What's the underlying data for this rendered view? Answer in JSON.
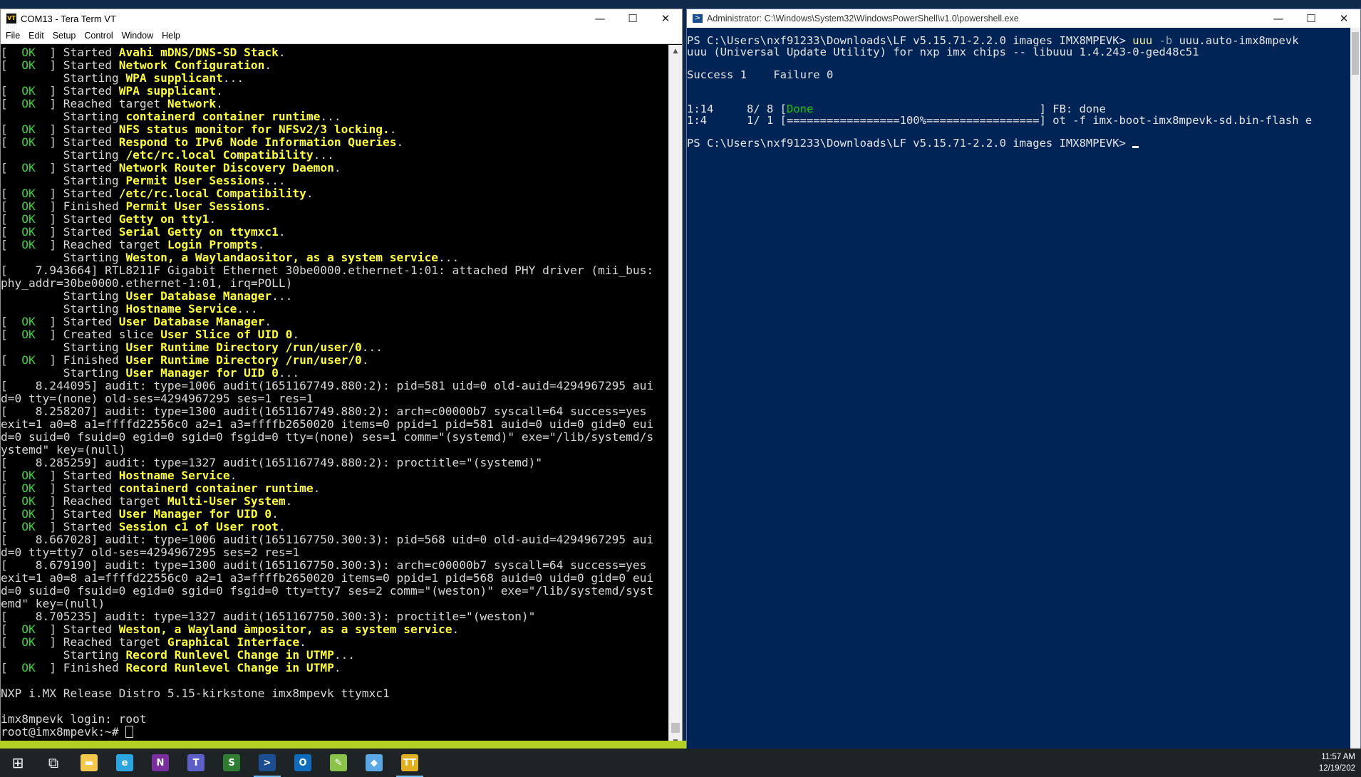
{
  "teraterm": {
    "title": "COM13 - Tera Term VT",
    "icon_label": "VT",
    "menu": [
      "File",
      "Edit",
      "Setup",
      "Control",
      "Window",
      "Help"
    ],
    "lines": [
      [
        [
          "[  ",
          "n"
        ],
        [
          "OK",
          "ok"
        ],
        [
          "  ] Started ",
          "n"
        ],
        [
          "Avahi mDNS/DNS-SD Stack",
          "hl"
        ],
        [
          ".",
          "n"
        ]
      ],
      [
        [
          "[  ",
          "n"
        ],
        [
          "OK",
          "ok"
        ],
        [
          "  ] Started ",
          "n"
        ],
        [
          "Network Configuration",
          "hl"
        ],
        [
          ".",
          "n"
        ]
      ],
      [
        [
          "         Starting ",
          "n"
        ],
        [
          "WPA supplicant",
          "hl"
        ],
        [
          "...",
          "n"
        ]
      ],
      [
        [
          "[  ",
          "n"
        ],
        [
          "OK",
          "ok"
        ],
        [
          "  ] Started ",
          "n"
        ],
        [
          "WPA supplicant",
          "hl"
        ],
        [
          ".",
          "n"
        ]
      ],
      [
        [
          "[  ",
          "n"
        ],
        [
          "OK",
          "ok"
        ],
        [
          "  ] Reached target ",
          "n"
        ],
        [
          "Network",
          "hl"
        ],
        [
          ".",
          "n"
        ]
      ],
      [
        [
          "         Starting ",
          "n"
        ],
        [
          "containerd container runtime",
          "hl"
        ],
        [
          "...",
          "n"
        ]
      ],
      [
        [
          "[  ",
          "n"
        ],
        [
          "OK",
          "ok"
        ],
        [
          "  ] Started ",
          "n"
        ],
        [
          "NFS status monitor for NFSv2/3 locking.",
          "hl"
        ],
        [
          ".",
          "n"
        ]
      ],
      [
        [
          "[  ",
          "n"
        ],
        [
          "OK",
          "ok"
        ],
        [
          "  ] Started ",
          "n"
        ],
        [
          "Respond to IPv6 Node Information Queries",
          "hl"
        ],
        [
          ".",
          "n"
        ]
      ],
      [
        [
          "         Starting ",
          "n"
        ],
        [
          "/etc/rc.local Compatibility",
          "hl"
        ],
        [
          "...",
          "n"
        ]
      ],
      [
        [
          "[  ",
          "n"
        ],
        [
          "OK",
          "ok"
        ],
        [
          "  ] Started ",
          "n"
        ],
        [
          "Network Router Discovery Daemon",
          "hl"
        ],
        [
          ".",
          "n"
        ]
      ],
      [
        [
          "         Starting ",
          "n"
        ],
        [
          "Permit User Sessions",
          "hl"
        ],
        [
          "...",
          "n"
        ]
      ],
      [
        [
          "[  ",
          "n"
        ],
        [
          "OK",
          "ok"
        ],
        [
          "  ] Started ",
          "n"
        ],
        [
          "/etc/rc.local Compatibility",
          "hl"
        ],
        [
          ".",
          "n"
        ]
      ],
      [
        [
          "[  ",
          "n"
        ],
        [
          "OK",
          "ok"
        ],
        [
          "  ] Finished ",
          "n"
        ],
        [
          "Permit User Sessions",
          "hl"
        ],
        [
          ".",
          "n"
        ]
      ],
      [
        [
          "[  ",
          "n"
        ],
        [
          "OK",
          "ok"
        ],
        [
          "  ] Started ",
          "n"
        ],
        [
          "Getty on tty1",
          "hl"
        ],
        [
          ".",
          "n"
        ]
      ],
      [
        [
          "[  ",
          "n"
        ],
        [
          "OK",
          "ok"
        ],
        [
          "  ] Started ",
          "n"
        ],
        [
          "Serial Getty on ttymxc1",
          "hl"
        ],
        [
          ".",
          "n"
        ]
      ],
      [
        [
          "[  ",
          "n"
        ],
        [
          "OK",
          "ok"
        ],
        [
          "  ] Reached target ",
          "n"
        ],
        [
          "Login Prompts",
          "hl"
        ],
        [
          ".",
          "n"
        ]
      ],
      [
        [
          "         Starting ",
          "n"
        ],
        [
          "Weston, a Waylandaositor, as a system service",
          "hl"
        ],
        [
          "...",
          "n"
        ]
      ],
      [
        [
          "[    7.943664] RTL8211F Gigabit Ethernet 30be0000.ethernet-1:01: attached PHY driver (mii_bus:",
          "n"
        ]
      ],
      [
        [
          "phy_addr=30be0000.ethernet-1:01, irq=POLL)",
          "n"
        ]
      ],
      [
        [
          "         Starting ",
          "n"
        ],
        [
          "User Database Manager",
          "hl"
        ],
        [
          "...",
          "n"
        ]
      ],
      [
        [
          "         Starting ",
          "n"
        ],
        [
          "Hostname Service",
          "hl"
        ],
        [
          "...",
          "n"
        ]
      ],
      [
        [
          "[  ",
          "n"
        ],
        [
          "OK",
          "ok"
        ],
        [
          "  ] Started ",
          "n"
        ],
        [
          "User Database Manager",
          "hl"
        ],
        [
          ".",
          "n"
        ]
      ],
      [
        [
          "[  ",
          "n"
        ],
        [
          "OK",
          "ok"
        ],
        [
          "  ] Created slice ",
          "n"
        ],
        [
          "User Slice of UID 0",
          "hl"
        ],
        [
          ".",
          "n"
        ]
      ],
      [
        [
          "         Starting ",
          "n"
        ],
        [
          "User Runtime Directory /run/user/0",
          "hl"
        ],
        [
          "...",
          "n"
        ]
      ],
      [
        [
          "[  ",
          "n"
        ],
        [
          "OK",
          "ok"
        ],
        [
          "  ] Finished ",
          "n"
        ],
        [
          "User Runtime Directory /run/user/0",
          "hl"
        ],
        [
          ".",
          "n"
        ]
      ],
      [
        [
          "         Starting ",
          "n"
        ],
        [
          "User Manager for UID 0",
          "hl"
        ],
        [
          "...",
          "n"
        ]
      ],
      [
        [
          "[    8.244095] audit: type=1006 audit(1651167749.880:2): pid=581 uid=0 old-auid=4294967295 aui",
          "n"
        ]
      ],
      [
        [
          "d=0 tty=(none) old-ses=4294967295 ses=1 res=1",
          "n"
        ]
      ],
      [
        [
          "[    8.258207] audit: type=1300 audit(1651167749.880:2): arch=c00000b7 syscall=64 success=yes",
          "n"
        ]
      ],
      [
        [
          "exit=1 a0=8 a1=ffffd22556c0 a2=1 a3=ffffb2650020 items=0 ppid=1 pid=581 auid=0 uid=0 gid=0 eui",
          "n"
        ]
      ],
      [
        [
          "d=0 suid=0 fsuid=0 egid=0 sgid=0 fsgid=0 tty=(none) ses=1 comm=\"(systemd)\" exe=\"/lib/systemd/s",
          "n"
        ]
      ],
      [
        [
          "ystemd\" key=(null)",
          "n"
        ]
      ],
      [
        [
          "[    8.285259] audit: type=1327 audit(1651167749.880:2): proctitle=\"(systemd)\"",
          "n"
        ]
      ],
      [
        [
          "[  ",
          "n"
        ],
        [
          "OK",
          "ok"
        ],
        [
          "  ] Started ",
          "n"
        ],
        [
          "Hostname Service",
          "hl"
        ],
        [
          ".",
          "n"
        ]
      ],
      [
        [
          "[  ",
          "n"
        ],
        [
          "OK",
          "ok"
        ],
        [
          "  ] Started ",
          "n"
        ],
        [
          "containerd container runtime",
          "hl"
        ],
        [
          ".",
          "n"
        ]
      ],
      [
        [
          "[  ",
          "n"
        ],
        [
          "OK",
          "ok"
        ],
        [
          "  ] Reached target ",
          "n"
        ],
        [
          "Multi-User System",
          "hl"
        ],
        [
          ".",
          "n"
        ]
      ],
      [
        [
          "[  ",
          "n"
        ],
        [
          "OK",
          "ok"
        ],
        [
          "  ] Started ",
          "n"
        ],
        [
          "User Manager for UID 0",
          "hl"
        ],
        [
          ".",
          "n"
        ]
      ],
      [
        [
          "[  ",
          "n"
        ],
        [
          "OK",
          "ok"
        ],
        [
          "  ] Started ",
          "n"
        ],
        [
          "Session c1 of User root",
          "hl"
        ],
        [
          ".",
          "n"
        ]
      ],
      [
        [
          "[    8.667028] audit: type=1006 audit(1651167750.300:3): pid=568 uid=0 old-auid=4294967295 aui",
          "n"
        ]
      ],
      [
        [
          "d=0 tty=tty7 old-ses=4294967295 ses=2 res=1",
          "n"
        ]
      ],
      [
        [
          "[    8.679190] audit: type=1300 audit(1651167750.300:3): arch=c00000b7 syscall=64 success=yes",
          "n"
        ]
      ],
      [
        [
          "exit=1 a0=8 a1=ffffd22556c0 a2=1 a3=ffffb2650020 items=0 ppid=1 pid=568 auid=0 uid=0 gid=0 eui",
          "n"
        ]
      ],
      [
        [
          "d=0 suid=0 fsuid=0 egid=0 sgid=0 fsgid=0 tty=tty7 ses=2 comm=\"(weston)\" exe=\"/lib/systemd/syst",
          "n"
        ]
      ],
      [
        [
          "emd\" key=(null)",
          "n"
        ]
      ],
      [
        [
          "[    8.705235] audit: type=1327 audit(1651167750.300:3): proctitle=\"(weston)\"",
          "n"
        ]
      ],
      [
        [
          "[  ",
          "n"
        ],
        [
          "OK",
          "ok"
        ],
        [
          "  ] Started ",
          "n"
        ],
        [
          "Weston, a Wayland àmpositor, as a system service",
          "hl"
        ],
        [
          ".",
          "n"
        ]
      ],
      [
        [
          "[  ",
          "n"
        ],
        [
          "OK",
          "ok"
        ],
        [
          "  ] Reached target ",
          "n"
        ],
        [
          "Graphical Interface",
          "hl"
        ],
        [
          ".",
          "n"
        ]
      ],
      [
        [
          "         Starting ",
          "n"
        ],
        [
          "Record Runlevel Change in UTMP",
          "hl"
        ],
        [
          "...",
          "n"
        ]
      ],
      [
        [
          "[  ",
          "n"
        ],
        [
          "OK",
          "ok"
        ],
        [
          "  ] Finished ",
          "n"
        ],
        [
          "Record Runlevel Change in UTMP",
          "hl"
        ],
        [
          ".",
          "n"
        ]
      ],
      [
        [
          "",
          "n"
        ]
      ],
      [
        [
          "NXP i.MX Release Distro 5.15-kirkstone imx8mpevk ttymxc1",
          "n"
        ]
      ],
      [
        [
          "",
          "n"
        ]
      ],
      [
        [
          "imx8mpevk login: root",
          "n"
        ]
      ],
      [
        [
          "root@imx8mpevk:~# ",
          "n"
        ]
      ]
    ]
  },
  "powershell": {
    "title": "Administrator: C:\\Windows\\System32\\WindowsPowerShell\\v1.0\\powershell.exe",
    "icon_label": ">",
    "lines": [
      [
        [
          "PS C:\\Users\\nxf91233\\Downloads\\LF_v5.15.71-2.2.0_images_IMX8MPEVK> ",
          "n"
        ],
        [
          "uuu ",
          "yel"
        ],
        [
          "-b ",
          "dim"
        ],
        [
          "uuu.auto-imx8mpevk",
          "n"
        ]
      ],
      [
        [
          "uuu (Universal Update Utility) for nxp imx chips -- libuuu_1.4.243-0-ged48c51",
          "n"
        ]
      ],
      [
        [
          "",
          "n"
        ]
      ],
      [
        [
          "Success 1    Failure 0",
          "n"
        ]
      ],
      [
        [
          "",
          "n"
        ]
      ],
      [
        [
          "",
          "n"
        ]
      ],
      [
        [
          "1:14     8/ 8 [",
          "n"
        ],
        [
          "Done",
          "green"
        ],
        [
          "                                  ] FB: done",
          "n"
        ]
      ],
      [
        [
          "1:4      1/ 1 [=================100%=================] ot -f imx-boot-imx8mpevk-sd.bin-flash_e",
          "n"
        ]
      ],
      [
        [
          "",
          "n"
        ]
      ],
      [
        [
          "PS C:\\Users\\nxf91233\\Downloads\\LF_v5.15.71-2.2.0_images_IMX8MPEVK> ",
          "n"
        ]
      ]
    ]
  },
  "window_controls": {
    "minimize": "—",
    "maximize": "☐",
    "close": "✕"
  },
  "taskbar": {
    "apps": [
      {
        "name": "start",
        "glyph": "⊞",
        "color": "#ffffff"
      },
      {
        "name": "task-view",
        "glyph": "⧉",
        "color": "#ffffff"
      },
      {
        "name": "file-explorer",
        "glyph": "▬",
        "color": "#f2c94c"
      },
      {
        "name": "edge",
        "glyph": "e",
        "color": "#2aa5e0"
      },
      {
        "name": "onenote",
        "glyph": "N",
        "color": "#7b2e9e"
      },
      {
        "name": "teams",
        "glyph": "T",
        "color": "#5b5fc7"
      },
      {
        "name": "s-app",
        "glyph": "S",
        "color": "#2e7d32"
      },
      {
        "name": "powershell",
        "glyph": ">",
        "color": "#1b4e91"
      },
      {
        "name": "outlook",
        "glyph": "O",
        "color": "#0f6cbd"
      },
      {
        "name": "notepad-plus",
        "glyph": "✎",
        "color": "#8bc34a"
      },
      {
        "name": "app-blue",
        "glyph": "◆",
        "color": "#5aa8e6"
      },
      {
        "name": "teraterm",
        "glyph": "TT",
        "color": "#e0b020"
      }
    ],
    "active": [
      "powershell",
      "teraterm"
    ],
    "time": "11:57 AM",
    "date": "12/19/202"
  }
}
